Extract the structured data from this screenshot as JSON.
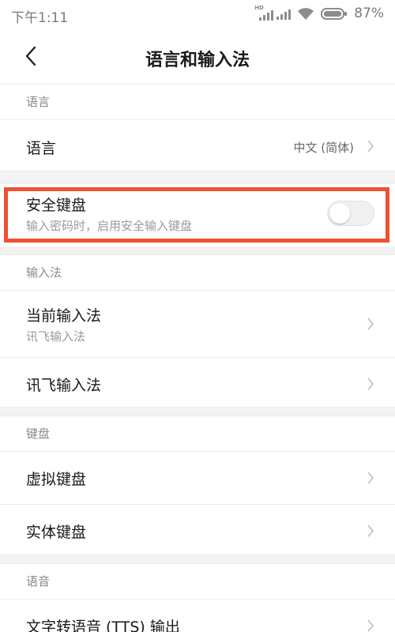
{
  "status_bar": {
    "time": "下午1:11",
    "hd_label": "HD",
    "battery_percent": "87%"
  },
  "header": {
    "title": "语言和输入法",
    "back_icon": "chevron-left-icon"
  },
  "sections": {
    "language": {
      "header": "语言",
      "rows": [
        {
          "title": "语言",
          "value": "中文 (简体)"
        }
      ]
    },
    "secure_keyboard": {
      "title": "安全键盘",
      "subtitle": "输入密码时，启用安全输入键盘",
      "enabled": false
    },
    "input_method": {
      "header": "输入法",
      "rows": [
        {
          "title": "当前输入法",
          "subtitle": "讯飞输入法"
        },
        {
          "title": "讯飞输入法"
        }
      ]
    },
    "keyboard": {
      "header": "键盘",
      "rows": [
        {
          "title": "虚拟键盘"
        },
        {
          "title": "实体键盘"
        }
      ]
    },
    "speech": {
      "header": "语音",
      "rows": [
        {
          "title": "文字转语音 (TTS) 输出"
        }
      ]
    }
  },
  "colors": {
    "highlight": "#f0502f",
    "section_gap": "#f2f2f2",
    "divider": "#ececec"
  }
}
